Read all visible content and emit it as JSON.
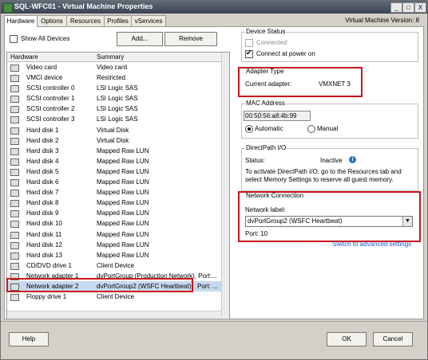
{
  "window": {
    "title": "SQL-WFC01 - Virtual Machine Properties",
    "minimize": "_",
    "maximize": "□",
    "close": "X"
  },
  "tabs": [
    {
      "label": "Hardware"
    },
    {
      "label": "Options"
    },
    {
      "label": "Resources"
    },
    {
      "label": "Profiles"
    },
    {
      "label": "vServices"
    }
  ],
  "vm_version": "Virtual Machine Version: 8",
  "left": {
    "show_all_devices": "Show All Devices",
    "add_button": "Add...",
    "remove_button": "Remove",
    "columns": {
      "hardware": "Hardware",
      "summary": "Summary"
    },
    "rows": [
      {
        "hardware": "Video card",
        "summary": "Video card",
        "icon": "video-card-icon"
      },
      {
        "hardware": "VMCI device",
        "summary": "Restricted",
        "icon": "vmci-icon"
      },
      {
        "hardware": "SCSI controller 0",
        "summary": "LSI Logic SAS",
        "icon": "scsi-icon"
      },
      {
        "hardware": "SCSI controller 1",
        "summary": "LSI Logic SAS",
        "icon": "scsi-icon"
      },
      {
        "hardware": "SCSI controller 2",
        "summary": "LSI Logic SAS",
        "icon": "scsi-icon"
      },
      {
        "hardware": "SCSI controller 3",
        "summary": "LSI Logic SAS",
        "icon": "scsi-icon"
      },
      {
        "hardware": "Hard disk 1",
        "summary": "Virtual Disk",
        "icon": "hard-disk-icon"
      },
      {
        "hardware": "Hard disk 2",
        "summary": "Virtual Disk",
        "icon": "hard-disk-icon"
      },
      {
        "hardware": "Hard disk 3",
        "summary": "Mapped Raw LUN",
        "icon": "hard-disk-icon"
      },
      {
        "hardware": "Hard disk 4",
        "summary": "Mapped Raw LUN",
        "icon": "hard-disk-icon"
      },
      {
        "hardware": "Hard disk 5",
        "summary": "Mapped Raw LUN",
        "icon": "hard-disk-icon"
      },
      {
        "hardware": "Hard disk 6",
        "summary": "Mapped Raw LUN",
        "icon": "hard-disk-icon"
      },
      {
        "hardware": "Hard disk 7",
        "summary": "Mapped Raw LUN",
        "icon": "hard-disk-icon"
      },
      {
        "hardware": "Hard disk 8",
        "summary": "Mapped Raw LUN",
        "icon": "hard-disk-icon"
      },
      {
        "hardware": "Hard disk 9",
        "summary": "Mapped Raw LUN",
        "icon": "hard-disk-icon"
      },
      {
        "hardware": "Hard disk 10",
        "summary": "Mapped Raw LUN",
        "icon": "hard-disk-icon"
      },
      {
        "hardware": "Hard disk 11",
        "summary": "Mapped Raw LUN",
        "icon": "hard-disk-icon"
      },
      {
        "hardware": "Hard disk 12",
        "summary": "Mapped Raw LUN",
        "icon": "hard-disk-icon"
      },
      {
        "hardware": "Hard disk 13",
        "summary": "Mapped Raw LUN",
        "icon": "hard-disk-icon"
      },
      {
        "hardware": "CD/DVD drive 1",
        "summary": "Client Device",
        "icon": "cd-dvd-icon"
      },
      {
        "hardware": "Network adapter 1",
        "summary": "dvPortGroup (Production Network), Port:...",
        "icon": "network-adapter-icon"
      },
      {
        "hardware": "Network adapter 2",
        "summary": "dvPortGroup2 (WSFC Heartbeat)",
        "summary_port": "Port: ...",
        "icon": "network-adapter-icon",
        "selected": true
      },
      {
        "hardware": "Floppy drive 1",
        "summary": "Client Device",
        "icon": "floppy-icon"
      }
    ]
  },
  "device_status": {
    "legend": "Device Status",
    "connected": "Connected",
    "connect_at_power_on": "Connect at power on"
  },
  "adapter_type": {
    "legend": "Adapter Type",
    "current_adapter_label": "Current adapter:",
    "current_adapter_value": "VMXNET 3"
  },
  "mac_address": {
    "legend": "MAC Address",
    "value": "00:50:56:a8:4b:99",
    "automatic": "Automatic",
    "manual": "Manual"
  },
  "directpath": {
    "legend": "DirectPath I/O",
    "status_label": "Status:",
    "status_value": "Inactive",
    "info": "To activate DirectPath I/O, go to the Resources tab and select Memory Settings to reserve all guest memory."
  },
  "network_connection": {
    "legend": "Network Connection",
    "network_label": "Network label:",
    "selected": "dvPortGroup2 (WSFC Heartbeat)",
    "port": "Port:  10",
    "advanced_link": "Switch to advanced settings"
  },
  "footer": {
    "help": "Help",
    "ok": "OK",
    "cancel": "Cancel"
  },
  "colors": {
    "highlight_red": "#c9151b",
    "link_blue": "#2255cc",
    "selected_row": "#c7d9ee"
  }
}
